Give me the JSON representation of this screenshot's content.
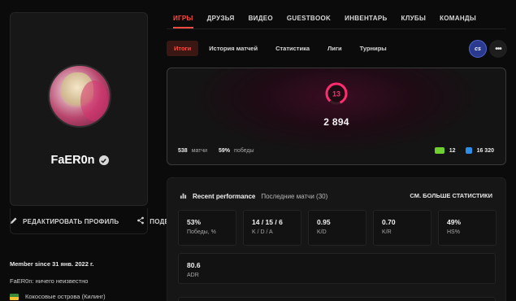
{
  "profile": {
    "nickname": "FaER0n",
    "edit_profile_label": "РЕДАКТИРОВАТЬ ПРОФИЛЬ",
    "share_label": "ПОДЕ",
    "member_since": "Member since 31 янв. 2022 г.",
    "bio": "FaER0n: ничего неизвестно",
    "location": "Кокосовые острова (Килинг)",
    "icons": [
      "verified-icon",
      "pencil-icon",
      "share-icon",
      "flag-icon"
    ]
  },
  "main_tabs": [
    {
      "label": "ИГРЫ",
      "active": true
    },
    {
      "label": "ДРУЗЬЯ",
      "active": false
    },
    {
      "label": "ВИДЕО",
      "active": false
    },
    {
      "label": "GUESTBOOK",
      "active": false
    },
    {
      "label": "ИНВЕНТАРЬ",
      "active": false
    },
    {
      "label": "КЛУБЫ",
      "active": false
    },
    {
      "label": "КОМАНДЫ",
      "active": false
    }
  ],
  "sub_tabs": [
    {
      "label": "Итоги",
      "active": true
    },
    {
      "label": "История матчей",
      "active": false
    },
    {
      "label": "Статистика",
      "active": false
    },
    {
      "label": "Лиги",
      "active": false
    },
    {
      "label": "Турниры",
      "active": false
    }
  ],
  "game_badge": "cs",
  "more_label": "•••",
  "elo": {
    "level": "13",
    "value": "2 894",
    "matches_value": "538",
    "matches_label": "матчи",
    "winrate_value": "59%",
    "winrate_label": "победы",
    "green_count": "12",
    "blue_count": "16 320"
  },
  "performance": {
    "title": "Recent performance",
    "subtitle": "Последние матчи (30)",
    "see_more": "СМ. БОЛЬШЕ СТАТИСТИКИ",
    "stats": [
      {
        "value": "53%",
        "label": "Победы, %"
      },
      {
        "value": "14 / 15 / 6",
        "label": "K / D / A"
      },
      {
        "value": "0.95",
        "label": "K/D"
      },
      {
        "value": "0.70",
        "label": "K/R"
      },
      {
        "value": "49%",
        "label": "HS%"
      }
    ],
    "adr": {
      "value": "80.6",
      "label": "ADR"
    }
  },
  "colors": {
    "accent": "#ff4a3d",
    "level_ring": "#ff2d6f",
    "background": "#0b0b0b"
  }
}
